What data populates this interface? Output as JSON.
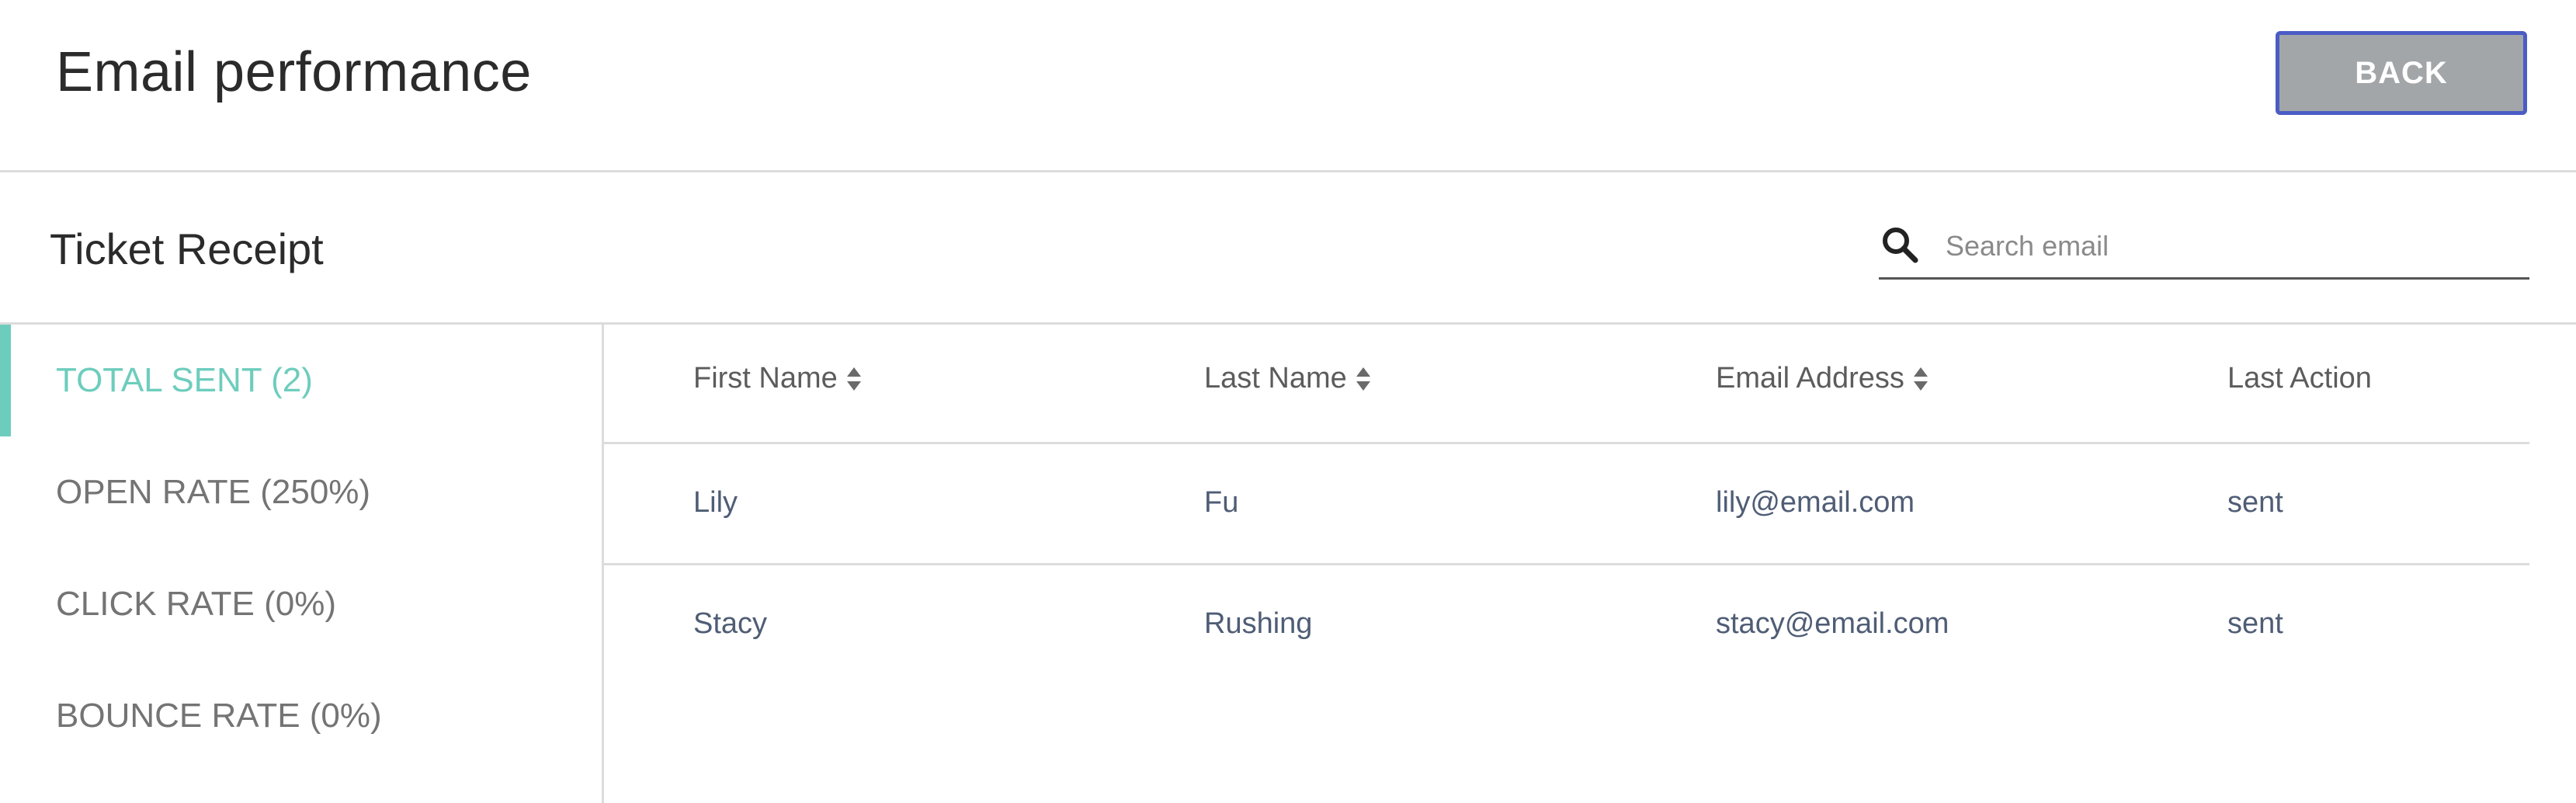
{
  "header": {
    "title": "Email performance",
    "back_label": "BACK"
  },
  "section": {
    "title": "Ticket Receipt"
  },
  "search": {
    "placeholder": "Search email",
    "value": ""
  },
  "sidebar": {
    "items": [
      {
        "label": "TOTAL SENT (2)",
        "active": true
      },
      {
        "label": "OPEN RATE (250%)",
        "active": false
      },
      {
        "label": "CLICK RATE (0%)",
        "active": false
      },
      {
        "label": "BOUNCE RATE (0%)",
        "active": false
      }
    ]
  },
  "table": {
    "columns": [
      "First Name",
      "Last Name",
      "Email Address",
      "Last Action"
    ],
    "rows": [
      [
        "Lily",
        "Fu",
        "lily@email.com",
        "sent"
      ],
      [
        "Stacy",
        "Rushing",
        "stacy@email.com",
        "sent"
      ]
    ]
  },
  "colors": {
    "accent": "#6dcdbd",
    "back_button_bg": "#a3a6a9",
    "back_button_border": "#4a5cc4",
    "cell_text": "#4f5d75"
  },
  "icons": {
    "search": "search-icon",
    "sort": "sort-icon"
  }
}
